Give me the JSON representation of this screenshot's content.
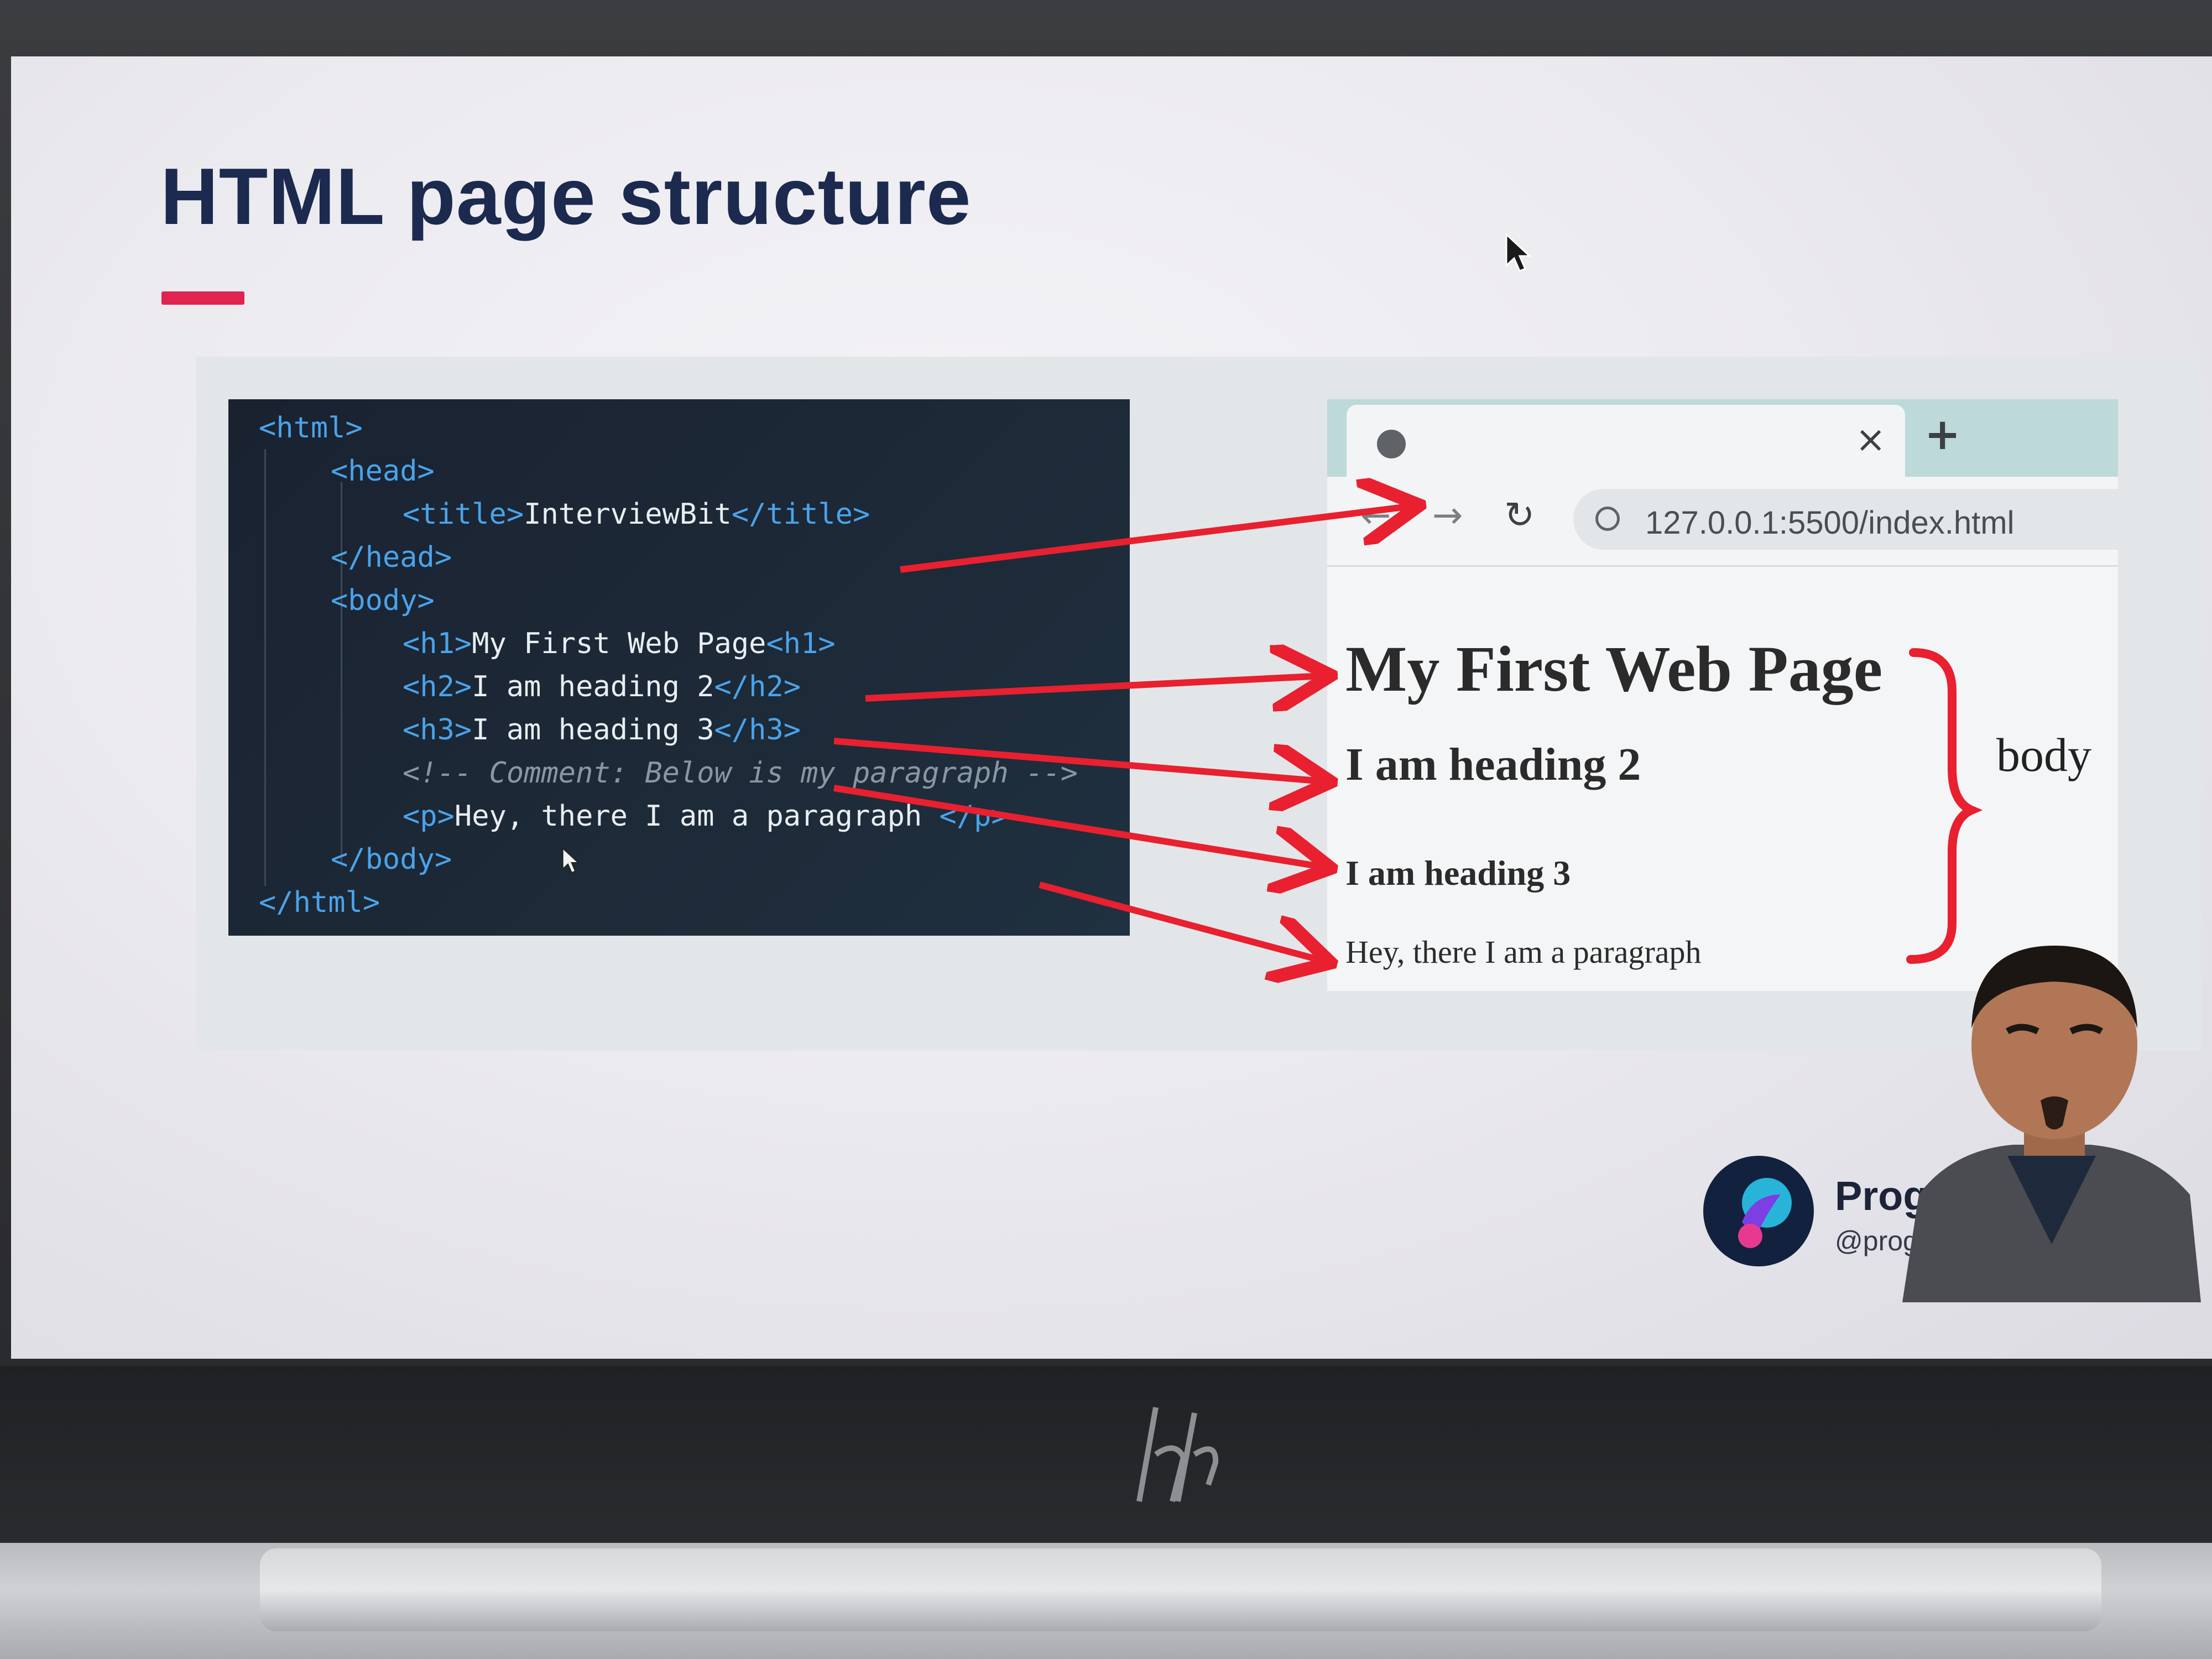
{
  "slide": {
    "title": "HTML page structure",
    "accent_color": "#e0234f",
    "title_color": "#1b2a4e"
  },
  "code": {
    "lines": [
      {
        "indent": 0,
        "parts": [
          {
            "t": "tag",
            "v": "<html>"
          }
        ]
      },
      {
        "indent": 1,
        "parts": [
          {
            "t": "tag",
            "v": "<head>"
          }
        ]
      },
      {
        "indent": 2,
        "parts": [
          {
            "t": "tag",
            "v": "<title>"
          },
          {
            "t": "text",
            "v": "InterviewBit"
          },
          {
            "t": "tag",
            "v": "</title>"
          }
        ]
      },
      {
        "indent": 1,
        "parts": [
          {
            "t": "tag",
            "v": "</head>"
          }
        ]
      },
      {
        "indent": 1,
        "parts": [
          {
            "t": "tag",
            "v": "<body>"
          }
        ]
      },
      {
        "indent": 2,
        "parts": [
          {
            "t": "tag",
            "v": "<h1>"
          },
          {
            "t": "text",
            "v": "My First Web Page"
          },
          {
            "t": "tag",
            "v": "<h1>"
          }
        ]
      },
      {
        "indent": 2,
        "parts": [
          {
            "t": "tag",
            "v": "<h2>"
          },
          {
            "t": "text",
            "v": "I am heading 2"
          },
          {
            "t": "tag",
            "v": "</h2>"
          }
        ]
      },
      {
        "indent": 2,
        "parts": [
          {
            "t": "tag",
            "v": "<h3>"
          },
          {
            "t": "text",
            "v": "I am heading 3"
          },
          {
            "t": "tag",
            "v": "</h3>"
          }
        ]
      },
      {
        "indent": 2,
        "parts": [
          {
            "t": "comment",
            "v": "<!-- Comment: Below is my paragraph -->"
          }
        ]
      },
      {
        "indent": 2,
        "parts": [
          {
            "t": "tag",
            "v": "<p>"
          },
          {
            "t": "text",
            "v": "Hey, there I am a paragraph "
          },
          {
            "t": "tag",
            "v": "</p>"
          }
        ]
      },
      {
        "indent": 1,
        "parts": [
          {
            "t": "tag",
            "v": "</body>"
          }
        ]
      },
      {
        "indent": 0,
        "parts": [
          {
            "t": "tag",
            "v": "</html>"
          }
        ]
      }
    ],
    "tag_color": "#4aa3ea",
    "text_color": "#e8eef2",
    "comment_color": "#8a97a3"
  },
  "browser": {
    "tab_icon": "globe-icon",
    "tab_close": "×",
    "new_tab": "+",
    "back": "←",
    "forward": "→",
    "reload": "↻",
    "url": "127.0.0.1:5500/index.html",
    "h1": "My First Web Page",
    "h2": "I am heading 2",
    "h3": "I am heading 3",
    "p": "Hey, there I am a paragraph"
  },
  "annotation": {
    "body_label": "body",
    "arrow_color": "#e8202f"
  },
  "brand": {
    "name": "Programmi",
    "handle": "@program"
  },
  "laptop": {
    "logo": "hp"
  }
}
